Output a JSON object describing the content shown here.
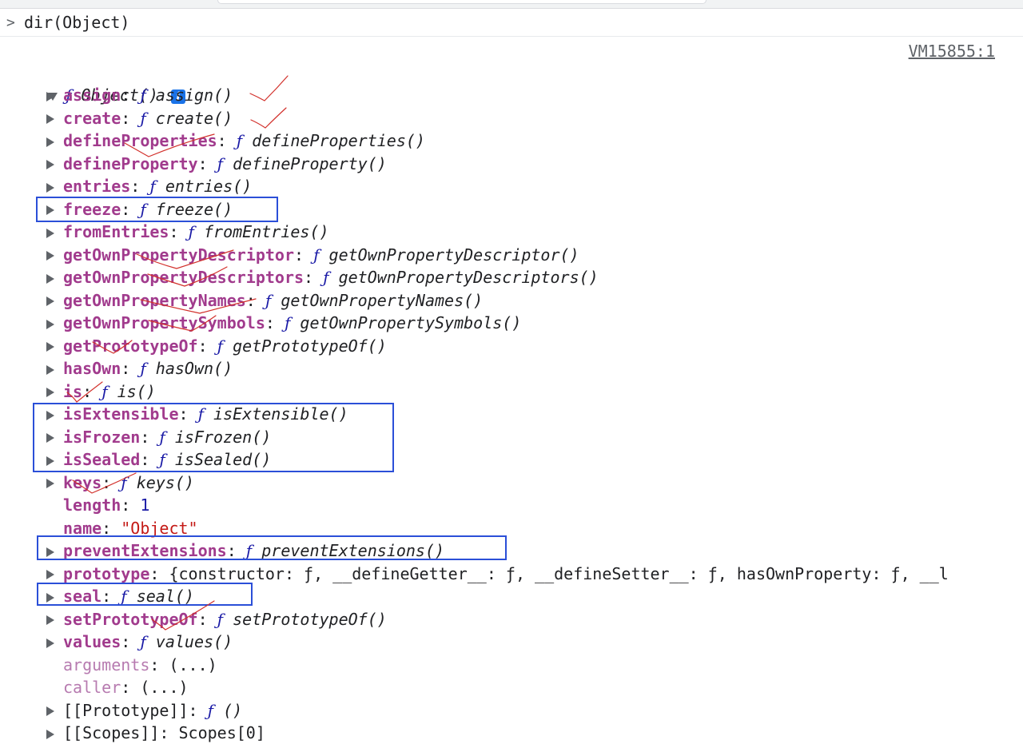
{
  "console": {
    "prompt_glyph": ">",
    "command": "dir(Object)",
    "source_link": "VM15855:1"
  },
  "object_header": {
    "f_symbol": "ƒ",
    "label": "Object()",
    "info_glyph": "i"
  },
  "properties": [
    {
      "key": "assign",
      "kind": "fn",
      "value": "assign()"
    },
    {
      "key": "create",
      "kind": "fn",
      "value": "create()"
    },
    {
      "key": "defineProperties",
      "kind": "fn",
      "value": "defineProperties()"
    },
    {
      "key": "defineProperty",
      "kind": "fn",
      "value": "defineProperty()"
    },
    {
      "key": "entries",
      "kind": "fn",
      "value": "entries()"
    },
    {
      "key": "freeze",
      "kind": "fn",
      "value": "freeze()"
    },
    {
      "key": "fromEntries",
      "kind": "fn",
      "value": "fromEntries()"
    },
    {
      "key": "getOwnPropertyDescriptor",
      "kind": "fn",
      "value": "getOwnPropertyDescriptor()"
    },
    {
      "key": "getOwnPropertyDescriptors",
      "kind": "fn",
      "value": "getOwnPropertyDescriptors()"
    },
    {
      "key": "getOwnPropertyNames",
      "kind": "fn",
      "value": "getOwnPropertyNames()"
    },
    {
      "key": "getOwnPropertySymbols",
      "kind": "fn",
      "value": "getOwnPropertySymbols()"
    },
    {
      "key": "getPrototypeOf",
      "kind": "fn",
      "value": "getPrototypeOf()"
    },
    {
      "key": "hasOwn",
      "kind": "fn",
      "value": "hasOwn()"
    },
    {
      "key": "is",
      "kind": "fn",
      "value": "is()"
    },
    {
      "key": "isExtensible",
      "kind": "fn",
      "value": "isExtensible()"
    },
    {
      "key": "isFrozen",
      "kind": "fn",
      "value": "isFrozen()"
    },
    {
      "key": "isSealed",
      "kind": "fn",
      "value": "isSealed()"
    },
    {
      "key": "keys",
      "kind": "fn",
      "value": "keys()"
    },
    {
      "key": "length",
      "kind": "num",
      "value": "1"
    },
    {
      "key": "name",
      "kind": "str",
      "value": "\"Object\""
    },
    {
      "key": "preventExtensions",
      "kind": "fn",
      "value": "preventExtensions()"
    },
    {
      "key": "prototype",
      "kind": "obj",
      "value": "{constructor: ƒ, __defineGetter__: ƒ, __defineSetter__: ƒ, hasOwnProperty: ƒ, __l"
    },
    {
      "key": "seal",
      "kind": "fn",
      "value": "seal()"
    },
    {
      "key": "setPrototypeOf",
      "kind": "fn",
      "value": "setPrototypeOf()"
    },
    {
      "key": "values",
      "kind": "fn",
      "value": "values()"
    },
    {
      "key": "arguments",
      "kind": "dim",
      "value": "(...)"
    },
    {
      "key": "caller",
      "kind": "dim",
      "value": "(...)"
    },
    {
      "key": "[[Prototype]]",
      "kind": "internal-fn",
      "value": "()"
    },
    {
      "key": "[[Scopes]]",
      "kind": "internal",
      "value": "Scopes[0]"
    }
  ],
  "f_symbol": "ƒ",
  "annotation_colors": {
    "box": "#2b4fd8",
    "check": "#d2302b"
  }
}
